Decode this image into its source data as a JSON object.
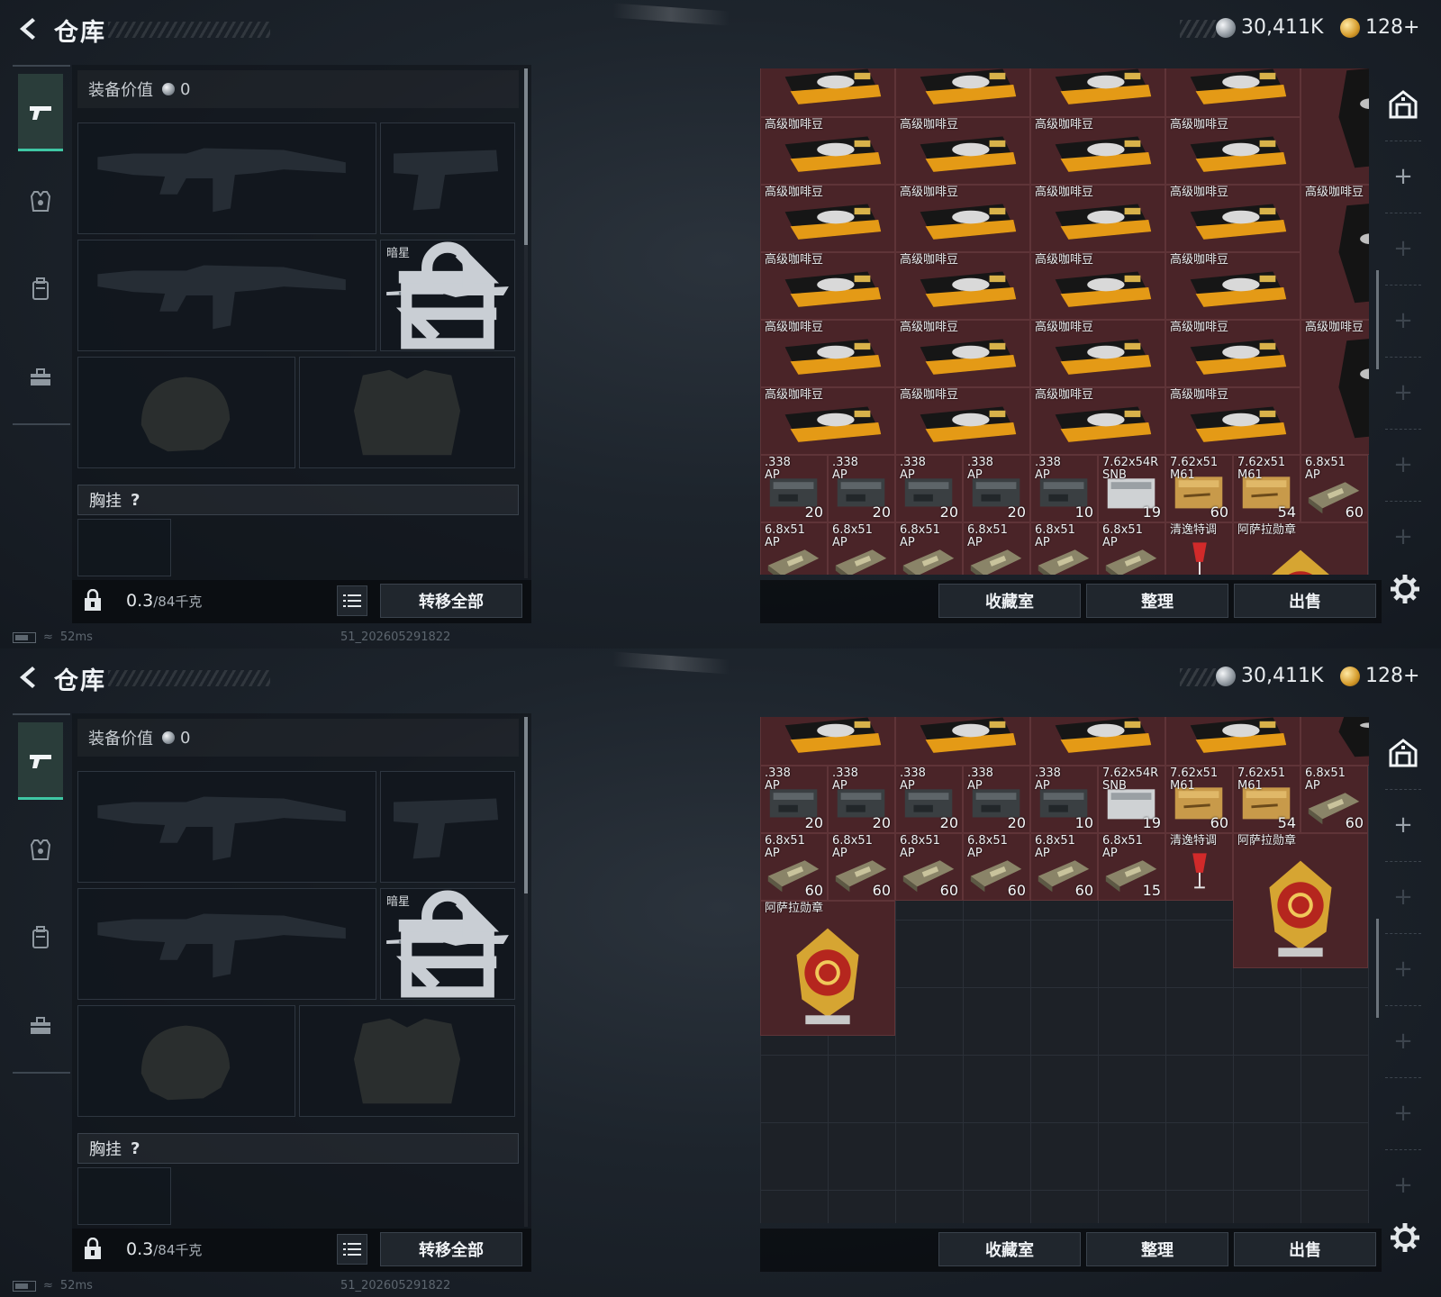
{
  "header": {
    "title": "仓库",
    "silver_amount": "30,411K",
    "gold_amount": "128+"
  },
  "loadout": {
    "value_label": "装备价值",
    "value_amount": "0",
    "melee_name": "暗星",
    "chest_label": "胸挂",
    "chest_help": "?",
    "weight_current": "0.3",
    "weight_max": "/84千克",
    "transfer_all": "转移全部"
  },
  "rail_tabs": [
    "weapon-tab",
    "armor-tab",
    "backpack-tab",
    "toolbox-tab"
  ],
  "status": {
    "ping": "52ms",
    "build": "51_202605291822"
  },
  "stash_actions": {
    "collection": "收藏室",
    "sort": "整理",
    "sell": "出售"
  },
  "screens": [
    {
      "items": [
        {
          "kind": "coffee",
          "name": "",
          "qty": "",
          "col": 0,
          "row": -0.28,
          "w": 1,
          "h": 1
        },
        {
          "kind": "coffee",
          "name": "",
          "qty": "",
          "col": 1,
          "row": -0.28,
          "w": 1,
          "h": 1
        },
        {
          "kind": "coffee",
          "name": "",
          "qty": "",
          "col": 2,
          "row": -0.28,
          "w": 1,
          "h": 1
        },
        {
          "kind": "coffee",
          "name": "",
          "qty": "",
          "col": 3,
          "row": -0.28,
          "w": 1,
          "h": 1
        },
        {
          "kind": "bag",
          "name": "",
          "qty": "",
          "col": 4,
          "row": -0.28,
          "w": 1,
          "h": 2
        },
        {
          "kind": "coffee",
          "name": "高级咖啡豆",
          "qty": "",
          "col": 0,
          "row": 0.72,
          "w": 1,
          "h": 1
        },
        {
          "kind": "coffee",
          "name": "高级咖啡豆",
          "qty": "",
          "col": 1,
          "row": 0.72,
          "w": 1,
          "h": 1
        },
        {
          "kind": "coffee",
          "name": "高级咖啡豆",
          "qty": "",
          "col": 2,
          "row": 0.72,
          "w": 1,
          "h": 1
        },
        {
          "kind": "coffee",
          "name": "高级咖啡豆",
          "qty": "",
          "col": 3,
          "row": 0.72,
          "w": 1,
          "h": 1
        },
        {
          "kind": "coffee",
          "name": "高级咖啡豆",
          "qty": "",
          "col": 0,
          "row": 1.72,
          "w": 1,
          "h": 1
        },
        {
          "kind": "coffee",
          "name": "高级咖啡豆",
          "qty": "",
          "col": 1,
          "row": 1.72,
          "w": 1,
          "h": 1
        },
        {
          "kind": "coffee",
          "name": "高级咖啡豆",
          "qty": "",
          "col": 2,
          "row": 1.72,
          "w": 1,
          "h": 1
        },
        {
          "kind": "coffee",
          "name": "高级咖啡豆",
          "qty": "",
          "col": 3,
          "row": 1.72,
          "w": 1,
          "h": 1
        },
        {
          "kind": "bag",
          "name": "高级咖啡豆",
          "qty": "",
          "col": 4,
          "row": 1.72,
          "w": 1,
          "h": 2
        },
        {
          "kind": "coffee",
          "name": "高级咖啡豆",
          "qty": "",
          "col": 0,
          "row": 2.72,
          "w": 1,
          "h": 1
        },
        {
          "kind": "coffee",
          "name": "高级咖啡豆",
          "qty": "",
          "col": 1,
          "row": 2.72,
          "w": 1,
          "h": 1
        },
        {
          "kind": "coffee",
          "name": "高级咖啡豆",
          "qty": "",
          "col": 2,
          "row": 2.72,
          "w": 1,
          "h": 1
        },
        {
          "kind": "coffee",
          "name": "高级咖啡豆",
          "qty": "",
          "col": 3,
          "row": 2.72,
          "w": 1,
          "h": 1
        },
        {
          "kind": "coffee",
          "name": "高级咖啡豆",
          "qty": "",
          "col": 0,
          "row": 3.72,
          "w": 1,
          "h": 1
        },
        {
          "kind": "coffee",
          "name": "高级咖啡豆",
          "qty": "",
          "col": 1,
          "row": 3.72,
          "w": 1,
          "h": 1
        },
        {
          "kind": "coffee",
          "name": "高级咖啡豆",
          "qty": "",
          "col": 2,
          "row": 3.72,
          "w": 1,
          "h": 1
        },
        {
          "kind": "coffee",
          "name": "高级咖啡豆",
          "qty": "",
          "col": 3,
          "row": 3.72,
          "w": 1,
          "h": 1
        },
        {
          "kind": "bag",
          "name": "高级咖啡豆",
          "qty": "",
          "col": 4,
          "row": 3.72,
          "w": 1,
          "h": 2
        },
        {
          "kind": "coffee",
          "name": "高级咖啡豆",
          "qty": "",
          "col": 0,
          "row": 4.72,
          "w": 1,
          "h": 1
        },
        {
          "kind": "coffee",
          "name": "高级咖啡豆",
          "qty": "",
          "col": 1,
          "row": 4.72,
          "w": 1,
          "h": 1
        },
        {
          "kind": "coffee",
          "name": "高级咖啡豆",
          "qty": "",
          "col": 2,
          "row": 4.72,
          "w": 1,
          "h": 1
        },
        {
          "kind": "coffee",
          "name": "高级咖啡豆",
          "qty": "",
          "col": 3,
          "row": 4.72,
          "w": 1,
          "h": 1
        },
        {
          "kind": "ammo-dark",
          "name": ".338\nAP",
          "qty": "20",
          "col": 0,
          "row": 5.72,
          "w": 0.5,
          "h": 1
        },
        {
          "kind": "ammo-dark",
          "name": ".338\nAP",
          "qty": "20",
          "col": 0.5,
          "row": 5.72,
          "w": 0.5,
          "h": 1
        },
        {
          "kind": "ammo-dark",
          "name": ".338\nAP",
          "qty": "20",
          "col": 1,
          "row": 5.72,
          "w": 0.5,
          "h": 1
        },
        {
          "kind": "ammo-dark",
          "name": ".338\nAP",
          "qty": "20",
          "col": 1.5,
          "row": 5.72,
          "w": 0.5,
          "h": 1
        },
        {
          "kind": "ammo-dark",
          "name": ".338\nAP",
          "qty": "10",
          "col": 2,
          "row": 5.72,
          "w": 0.5,
          "h": 1
        },
        {
          "kind": "ammo-white",
          "name": "7.62x54R\nSNB",
          "qty": "19",
          "col": 2.5,
          "row": 5.72,
          "w": 0.5,
          "h": 1
        },
        {
          "kind": "ammo-tan",
          "name": "7.62x51\nM61",
          "qty": "60",
          "col": 3,
          "row": 5.72,
          "w": 0.5,
          "h": 1
        },
        {
          "kind": "ammo-tan",
          "name": "7.62x51\nM61",
          "qty": "54",
          "col": 3.5,
          "row": 5.72,
          "w": 0.5,
          "h": 1
        },
        {
          "kind": "ammo-green",
          "name": "6.8x51\nAP",
          "qty": "60",
          "col": 4,
          "row": 5.72,
          "w": 0.5,
          "h": 1
        },
        {
          "kind": "ammo-green",
          "name": "6.8x51\nAP",
          "qty": "",
          "col": 0,
          "row": 6.72,
          "w": 0.5,
          "h": 1
        },
        {
          "kind": "ammo-green",
          "name": "6.8x51\nAP",
          "qty": "",
          "col": 0.5,
          "row": 6.72,
          "w": 0.5,
          "h": 1
        },
        {
          "kind": "ammo-green",
          "name": "6.8x51\nAP",
          "qty": "",
          "col": 1,
          "row": 6.72,
          "w": 0.5,
          "h": 1
        },
        {
          "kind": "ammo-green",
          "name": "6.8x51\nAP",
          "qty": "",
          "col": 1.5,
          "row": 6.72,
          "w": 0.5,
          "h": 1
        },
        {
          "kind": "ammo-green",
          "name": "6.8x51\nAP",
          "qty": "",
          "col": 2,
          "row": 6.72,
          "w": 0.5,
          "h": 1
        },
        {
          "kind": "ammo-green",
          "name": "6.8x51\nAP",
          "qty": "",
          "col": 2.5,
          "row": 6.72,
          "w": 0.5,
          "h": 1
        },
        {
          "kind": "drink",
          "name": "清逸特调",
          "qty": "",
          "col": 3,
          "row": 6.72,
          "w": 0.5,
          "h": 1
        },
        {
          "kind": "medal",
          "name": "阿萨拉勋章",
          "qty": "",
          "col": 3.5,
          "row": 6.72,
          "w": 1,
          "h": 2
        }
      ]
    },
    {
      "items": [
        {
          "kind": "coffee",
          "name": "",
          "qty": "",
          "col": 0,
          "row": -0.28,
          "w": 1,
          "h": 1
        },
        {
          "kind": "coffee",
          "name": "",
          "qty": "",
          "col": 1,
          "row": -0.28,
          "w": 1,
          "h": 1
        },
        {
          "kind": "coffee",
          "name": "",
          "qty": "",
          "col": 2,
          "row": -0.28,
          "w": 1,
          "h": 1
        },
        {
          "kind": "coffee",
          "name": "",
          "qty": "",
          "col": 3,
          "row": -0.28,
          "w": 1,
          "h": 1
        },
        {
          "kind": "bag",
          "name": "",
          "qty": "",
          "col": 4,
          "row": -0.28,
          "w": 1,
          "h": 1
        },
        {
          "kind": "ammo-dark",
          "name": ".338\nAP",
          "qty": "20",
          "col": 0,
          "row": 0.72,
          "w": 0.5,
          "h": 1
        },
        {
          "kind": "ammo-dark",
          "name": ".338\nAP",
          "qty": "20",
          "col": 0.5,
          "row": 0.72,
          "w": 0.5,
          "h": 1
        },
        {
          "kind": "ammo-dark",
          "name": ".338\nAP",
          "qty": "20",
          "col": 1,
          "row": 0.72,
          "w": 0.5,
          "h": 1
        },
        {
          "kind": "ammo-dark",
          "name": ".338\nAP",
          "qty": "20",
          "col": 1.5,
          "row": 0.72,
          "w": 0.5,
          "h": 1
        },
        {
          "kind": "ammo-dark",
          "name": ".338\nAP",
          "qty": "10",
          "col": 2,
          "row": 0.72,
          "w": 0.5,
          "h": 1
        },
        {
          "kind": "ammo-white",
          "name": "7.62x54R\nSNB",
          "qty": "19",
          "col": 2.5,
          "row": 0.72,
          "w": 0.5,
          "h": 1
        },
        {
          "kind": "ammo-tan",
          "name": "7.62x51\nM61",
          "qty": "60",
          "col": 3,
          "row": 0.72,
          "w": 0.5,
          "h": 1
        },
        {
          "kind": "ammo-tan",
          "name": "7.62x51\nM61",
          "qty": "54",
          "col": 3.5,
          "row": 0.72,
          "w": 0.5,
          "h": 1
        },
        {
          "kind": "ammo-green",
          "name": "6.8x51\nAP",
          "qty": "60",
          "col": 4,
          "row": 0.72,
          "w": 0.5,
          "h": 1
        },
        {
          "kind": "ammo-green",
          "name": "6.8x51\nAP",
          "qty": "60",
          "col": 0,
          "row": 1.72,
          "w": 0.5,
          "h": 1
        },
        {
          "kind": "ammo-green",
          "name": "6.8x51\nAP",
          "qty": "60",
          "col": 0.5,
          "row": 1.72,
          "w": 0.5,
          "h": 1
        },
        {
          "kind": "ammo-green",
          "name": "6.8x51\nAP",
          "qty": "60",
          "col": 1,
          "row": 1.72,
          "w": 0.5,
          "h": 1
        },
        {
          "kind": "ammo-green",
          "name": "6.8x51\nAP",
          "qty": "60",
          "col": 1.5,
          "row": 1.72,
          "w": 0.5,
          "h": 1
        },
        {
          "kind": "ammo-green",
          "name": "6.8x51\nAP",
          "qty": "60",
          "col": 2,
          "row": 1.72,
          "w": 0.5,
          "h": 1
        },
        {
          "kind": "ammo-green",
          "name": "6.8x51\nAP",
          "qty": "15",
          "col": 2.5,
          "row": 1.72,
          "w": 0.5,
          "h": 1
        },
        {
          "kind": "drink",
          "name": "清逸特调",
          "qty": "",
          "col": 3,
          "row": 1.72,
          "w": 0.5,
          "h": 1
        },
        {
          "kind": "medal",
          "name": "阿萨拉勋章",
          "qty": "",
          "col": 3.5,
          "row": 1.72,
          "w": 1,
          "h": 2
        },
        {
          "kind": "medal",
          "name": "阿萨拉勋章",
          "qty": "",
          "col": 0,
          "row": 2.72,
          "w": 1,
          "h": 2
        }
      ]
    }
  ]
}
